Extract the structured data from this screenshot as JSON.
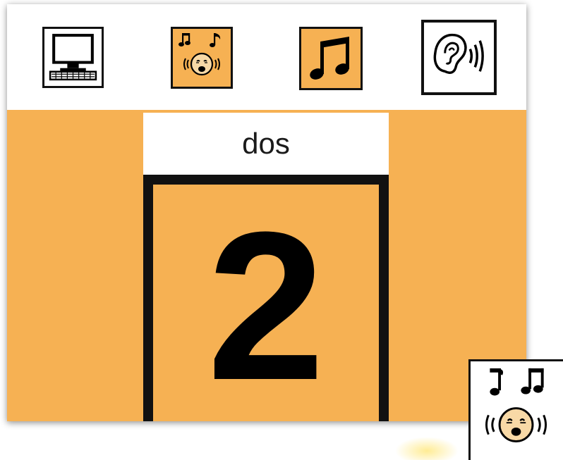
{
  "board": {
    "word": "dos",
    "number": "2"
  },
  "toolbar": {
    "buttons": [
      {
        "icon": "computer-icon"
      },
      {
        "icon": "singing-face-icon"
      },
      {
        "icon": "music-note-icon"
      },
      {
        "icon": "ear-listening-icon"
      }
    ]
  },
  "colors": {
    "board_background": "#f6b153",
    "frame": "#111111",
    "text": "#1b1b1b"
  }
}
